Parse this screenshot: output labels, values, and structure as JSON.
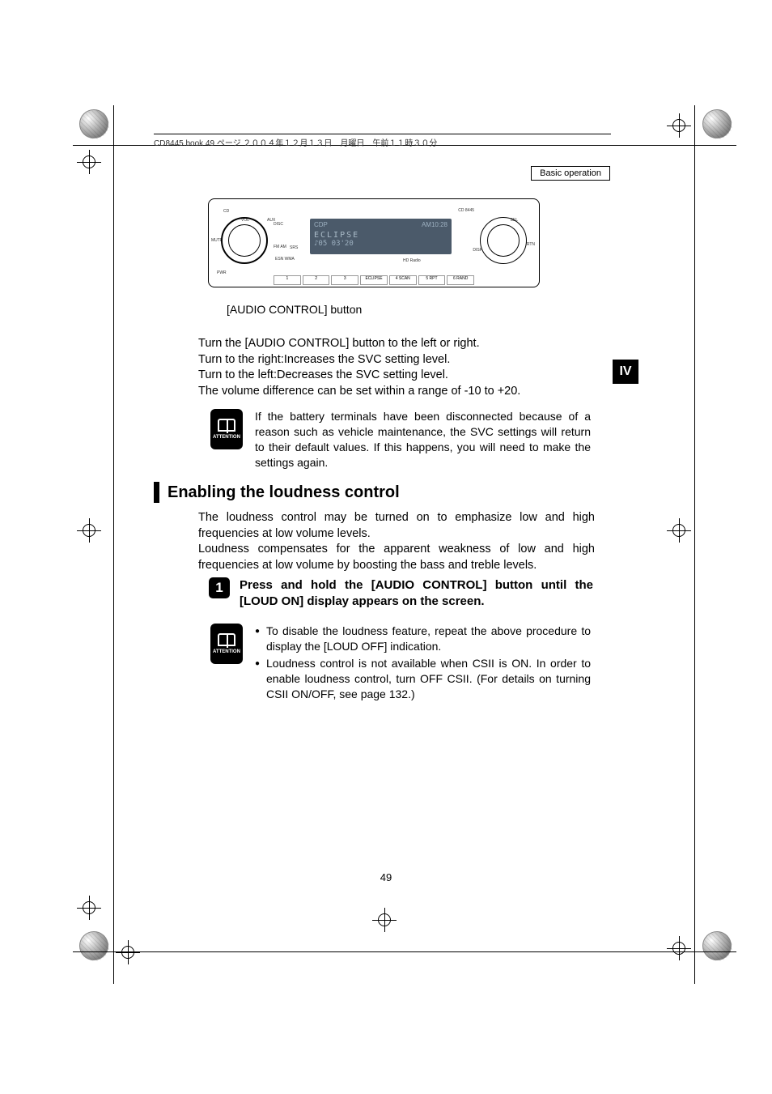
{
  "pageInfo": "CD8445.book  49 ページ  ２００４年１２月１３日　月曜日　午前１１時３０分",
  "chapterLabel": "Basic operation",
  "sectionTab": "IV",
  "faceplate": {
    "model": "CD 8445",
    "labels": {
      "cd": "CD",
      "vol": "VOL",
      "mute": "MUTE",
      "pwr": "PWR",
      "aux": "AUX",
      "disc": "DISC",
      "fmam": "FM AM",
      "sel": "SEL",
      "rtn": "RTN",
      "disp": "DISP",
      "esn": "ESN WMA",
      "srs": "SRS",
      "hd": "HD Radio"
    },
    "display": {
      "topLeft": "CDP",
      "topRight": "AM10:28",
      "mid": "ECLIPSE",
      "bot": "♪05     03'20"
    },
    "buttons": [
      "1",
      "2",
      "3",
      "ECLIPSE",
      "4 SCAN",
      "5 RPT",
      "6 RAND"
    ]
  },
  "figureCaption": "[AUDIO CONTROL] button",
  "body1_line1": "Turn the [AUDIO CONTROL] button to the left or right.",
  "body1_line2": "Turn to the right:Increases the SVC setting level.",
  "body1_line3": "Turn to the left:Decreases the SVC setting level.",
  "body1_line4": "The volume difference can be set within a range of -10 to +20.",
  "attentionLabel": "ATTENTION",
  "attention1": "If the battery terminals have been disconnected because of a reason such as vehicle maintenance, the SVC settings will return to their default values. If this happens, you will need to make the settings again.",
  "sectionTitle": "Enabling the loudness control",
  "body2_p1": "The loudness control may be turned on to emphasize low and high frequencies at low volume levels.",
  "body2_p2": "Loudness compensates for the apparent weakness of low and high frequencies at low volume by boosting the bass and treble levels.",
  "step1_num": "1",
  "step1_text": "Press and hold the [AUDIO CONTROL] button until the [LOUD ON] display appears on the screen.",
  "attention2_b1": "To disable the loudness feature, repeat the above procedure to display the [LOUD OFF] indication.",
  "attention2_b2": "Loudness control is not available when CSII is ON. In order to enable loudness control, turn OFF CSII. (For details on turning CSII ON/OFF, see page 132.)",
  "pageNum": "49"
}
